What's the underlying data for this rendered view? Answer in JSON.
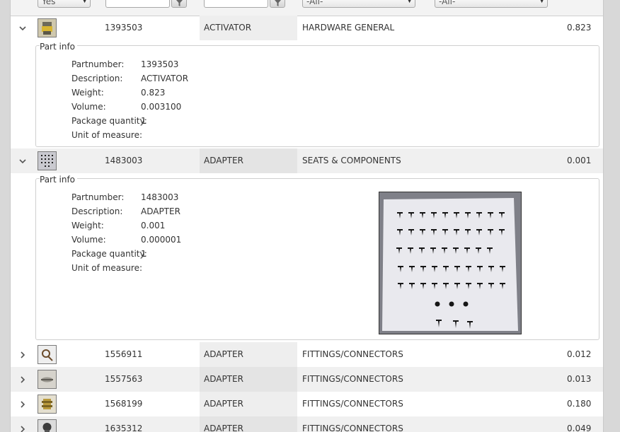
{
  "filters": {
    "yes_select": "Yes",
    "all_select_1": "-All-",
    "all_select_2": "-All-"
  },
  "detail_labels": {
    "legend": "Part info",
    "partnumber": "Partnumber:",
    "description": "Description:",
    "weight": "Weight:",
    "volume": "Volume:",
    "package_quantity": "Package quantity:",
    "unit_of_measure": "Unit of measure:"
  },
  "rows": [
    {
      "part": "1393503",
      "name": "ACTIVATOR",
      "category": "HARDWARE GENERAL",
      "weight": "0.823",
      "detail": {
        "partnumber": "1393503",
        "description": "ACTIVATOR",
        "weight": "0.823",
        "volume": "0.003100",
        "package_quantity": "1",
        "unit_of_measure": ""
      }
    },
    {
      "part": "1483003",
      "name": "ADAPTER",
      "category": "SEATS & COMPONENTS",
      "weight": "0.001",
      "detail": {
        "partnumber": "1483003",
        "description": "ADAPTER",
        "weight": "0.001",
        "volume": "0.000001",
        "package_quantity": "1",
        "unit_of_measure": ""
      }
    },
    {
      "part": "1556911",
      "name": "ADAPTER",
      "category": "FITTINGS/CONNECTORS",
      "weight": "0.012"
    },
    {
      "part": "1557563",
      "name": "ADAPTER",
      "category": "FITTINGS/CONNECTORS",
      "weight": "0.013"
    },
    {
      "part": "1568199",
      "name": "ADAPTER",
      "category": "FITTINGS/CONNECTORS",
      "weight": "0.180"
    },
    {
      "part": "1635312",
      "name": "ADAPTER",
      "category": "FITTINGS/CONNECTORS",
      "weight": "0.049"
    }
  ],
  "icons": {
    "expanded": "chevron-down-icon",
    "collapsed": "chevron-right-icon",
    "filter": "funnel-icon"
  }
}
